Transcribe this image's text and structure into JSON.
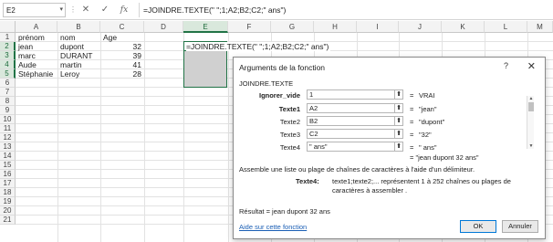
{
  "formula_bar": {
    "name_box": "E2",
    "cancel_icon": "✕",
    "enter_icon": "✓",
    "fx_label": "fx",
    "formula": "=JOINDRE.TEXTE(\" \";1;A2;B2;C2;\" ans\")"
  },
  "grid": {
    "columns": [
      "A",
      "B",
      "C",
      "D",
      "E",
      "F",
      "G",
      "H",
      "I",
      "J",
      "K",
      "L",
      "M"
    ],
    "rows": [
      "1",
      "2",
      "3",
      "4",
      "5",
      "6",
      "7",
      "8",
      "9",
      "10",
      "11",
      "12",
      "13",
      "14",
      "15",
      "16",
      "17",
      "18",
      "19",
      "20",
      "21"
    ],
    "selected_column": "E",
    "selected_rows": [
      "2",
      "3",
      "4",
      "5"
    ],
    "cells": {
      "A1": "prénom",
      "B1": "nom",
      "C1": "Age",
      "A2": "jean",
      "B2": "dupont",
      "C2": "32",
      "A3": "marc",
      "B3": "DURANT",
      "C3": "39",
      "A4": "Aude",
      "B4": "martin",
      "C4": "41",
      "A5": "Stéphanie",
      "B5": "Leroy",
      "C5": "28"
    },
    "editing_text": "=JOINDRE.TEXTE(\" \";1;A2;B2;C2;\" ans\")"
  },
  "dialog": {
    "title": "Arguments de la fonction",
    "help_icon": "?",
    "close_icon": "✕",
    "function_name": "JOINDRE.TEXTE",
    "arguments": [
      {
        "label": "Ignorer_vide",
        "value": "1",
        "result": "VRAI",
        "bold": true
      },
      {
        "label": "Texte1",
        "value": "A2",
        "result": "\"jean\"",
        "bold": true
      },
      {
        "label": "Texte2",
        "value": "B2",
        "result": "\"dupont\"",
        "bold": false
      },
      {
        "label": "Texte3",
        "value": "C2",
        "result": "\"32\"",
        "bold": false
      },
      {
        "label": "Texte4",
        "value": "\" ans\"",
        "result": "\" ans\"",
        "bold": false
      }
    ],
    "formula_result": "= \"jean dupont 32  ans\"",
    "description": "Assemble une liste ou plage de chaînes de caractères à l'aide d'un délimiteur.",
    "arg_desc_label": "Texte4:",
    "arg_desc_text": "texte1;texte2;... représentent 1 à 252 chaînes ou plages de caractères à assembler .",
    "result_label": "Résultat =  jean dupont 32  ans",
    "help_link": "Aide sur cette fonction",
    "ok_label": "OK",
    "cancel_label": "Annuler"
  }
}
